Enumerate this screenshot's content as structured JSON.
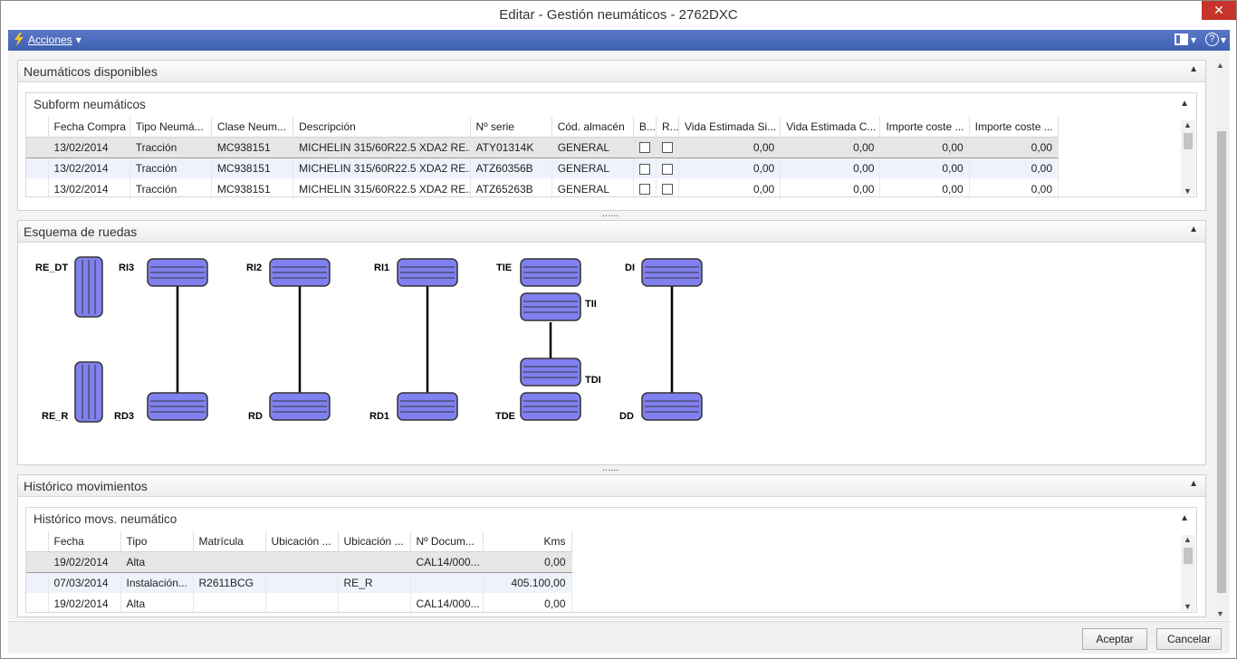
{
  "window": {
    "title": "Editar - Gestión neumáticos - 2762DXC",
    "close_glyph": "✕"
  },
  "actionbar": {
    "label": "Acciones",
    "caret": "▾",
    "help_glyph": "?",
    "caret2": "▾"
  },
  "sections": {
    "disponibles": {
      "title": "Neumáticos disponibles"
    },
    "esquema": {
      "title": "Esquema de ruedas"
    },
    "historico": {
      "title": "Histórico movimientos"
    }
  },
  "subform": {
    "title": "Subform neumáticos",
    "columns": [
      "Fecha Compra",
      "Tipo Neumá...",
      "Clase Neum...",
      "Descripción",
      "Nº serie",
      "Cód. almacén",
      "B...",
      "R...",
      "Vida Estimada Si...",
      "Vida Estimada C...",
      "Importe coste ...",
      "Importe coste ..."
    ],
    "rows": [
      {
        "fecha": "13/02/2014",
        "tipo": "Tracción",
        "clase": "MC938151",
        "desc": "MICHELIN 315/60R22.5 XDA2 RE...",
        "serie": "ATY01314K",
        "almacen": "GENERAL",
        "v1": "0,00",
        "v2": "0,00",
        "i1": "0,00",
        "i2": "0,00"
      },
      {
        "fecha": "13/02/2014",
        "tipo": "Tracción",
        "clase": "MC938151",
        "desc": "MICHELIN 315/60R22.5 XDA2 RE...",
        "serie": "ATZ60356B",
        "almacen": "GENERAL",
        "v1": "0,00",
        "v2": "0,00",
        "i1": "0,00",
        "i2": "0,00"
      },
      {
        "fecha": "13/02/2014",
        "tipo": "Tracción",
        "clase": "MC938151",
        "desc": "MICHELIN 315/60R22.5 XDA2 RE...",
        "serie": "ATZ65263B",
        "almacen": "GENERAL",
        "v1": "0,00",
        "v2": "0,00",
        "i1": "0,00",
        "i2": "0,00"
      }
    ]
  },
  "wheels": {
    "labels": [
      "RE_DT",
      "RE_R",
      "RI3",
      "RD3",
      "RI2",
      "RD",
      "RI1",
      "RD1",
      "TIE",
      "TII",
      "TDI",
      "TDE",
      "DI",
      "DD"
    ],
    "color": "#8080f0"
  },
  "historico": {
    "title": "Histórico movs. neumático",
    "columns": [
      "Fecha",
      "Tipo",
      "Matrícula",
      "Ubicación ...",
      "Ubicación ...",
      "Nº Docum...",
      "Kms"
    ],
    "rows": [
      {
        "fecha": "19/02/2014",
        "tipo": "Alta",
        "matricula": "",
        "u1": "",
        "u2": "",
        "doc": "CAL14/000...",
        "kms": "0,00"
      },
      {
        "fecha": "07/03/2014",
        "tipo": "Instalación...",
        "matricula": "R2611BCG",
        "u1": "",
        "u2": "RE_R",
        "doc": "",
        "kms": "405.100,00"
      },
      {
        "fecha": "19/02/2014",
        "tipo": "Alta",
        "matricula": "",
        "u1": "",
        "u2": "",
        "doc": "CAL14/000...",
        "kms": "0,00"
      }
    ]
  },
  "splitter": {
    "dots": "......"
  },
  "footer": {
    "accept": "Aceptar",
    "cancel": "Cancelar"
  }
}
